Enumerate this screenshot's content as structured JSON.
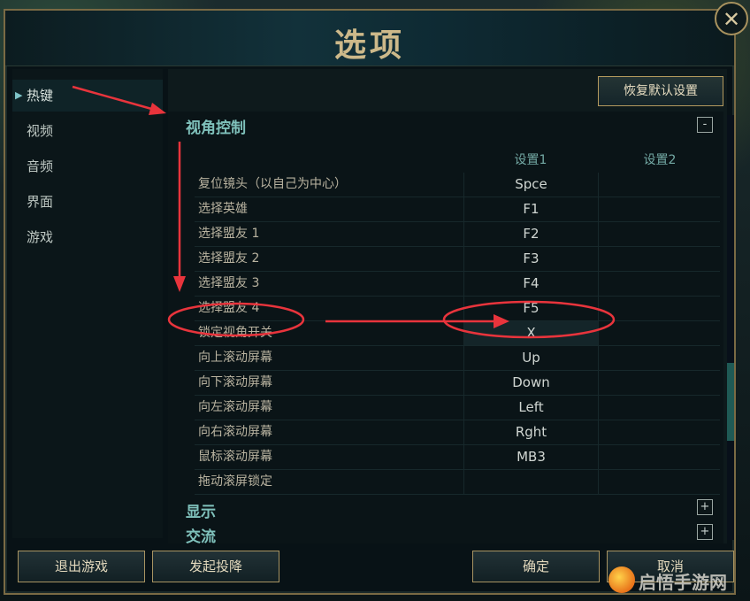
{
  "window": {
    "title": "选项",
    "close_label": "✕"
  },
  "sidebar": {
    "items": [
      {
        "label": "热键",
        "active": true
      },
      {
        "label": "视频",
        "active": false
      },
      {
        "label": "音频",
        "active": false
      },
      {
        "label": "界面",
        "active": false
      },
      {
        "label": "游戏",
        "active": false
      }
    ]
  },
  "main": {
    "restore_defaults_label": "恢复默认设置",
    "sections": [
      {
        "title": "视角控制",
        "toggle": "-"
      },
      {
        "title": "显示",
        "toggle": "+"
      },
      {
        "title": "交流",
        "toggle": "+"
      }
    ],
    "columns": {
      "setting1": "设置1",
      "setting2": "设置2"
    },
    "rows": [
      {
        "label": "复位镜头（以自己为中心）",
        "setting1": "Spce",
        "setting2": ""
      },
      {
        "label": "选择英雄",
        "setting1": "F1",
        "setting2": ""
      },
      {
        "label": "选择盟友 1",
        "setting1": "F2",
        "setting2": ""
      },
      {
        "label": "选择盟友 2",
        "setting1": "F3",
        "setting2": ""
      },
      {
        "label": "选择盟友 3",
        "setting1": "F4",
        "setting2": ""
      },
      {
        "label": "选择盟友 4",
        "setting1": "F5",
        "setting2": ""
      },
      {
        "label": "锁定视角开关",
        "setting1": "X",
        "setting2": ""
      },
      {
        "label": "向上滚动屏幕",
        "setting1": "Up",
        "setting2": ""
      },
      {
        "label": "向下滚动屏幕",
        "setting1": "Down",
        "setting2": ""
      },
      {
        "label": "向左滚动屏幕",
        "setting1": "Left",
        "setting2": ""
      },
      {
        "label": "向右滚动屏幕",
        "setting1": "Rght",
        "setting2": ""
      },
      {
        "label": "鼠标滚动屏幕",
        "setting1": "MB3",
        "setting2": ""
      },
      {
        "label": "拖动滚屏锁定",
        "setting1": "",
        "setting2": ""
      }
    ]
  },
  "footer": {
    "exit_game": "退出游戏",
    "surrender": "发起投降",
    "confirm": "确定",
    "cancel": "取消"
  },
  "watermark": {
    "text": "启悟手游网"
  },
  "colors": {
    "annotation": "#e8343c",
    "accent_gold": "#b49a5e",
    "accent_teal": "#7fc1bb"
  }
}
